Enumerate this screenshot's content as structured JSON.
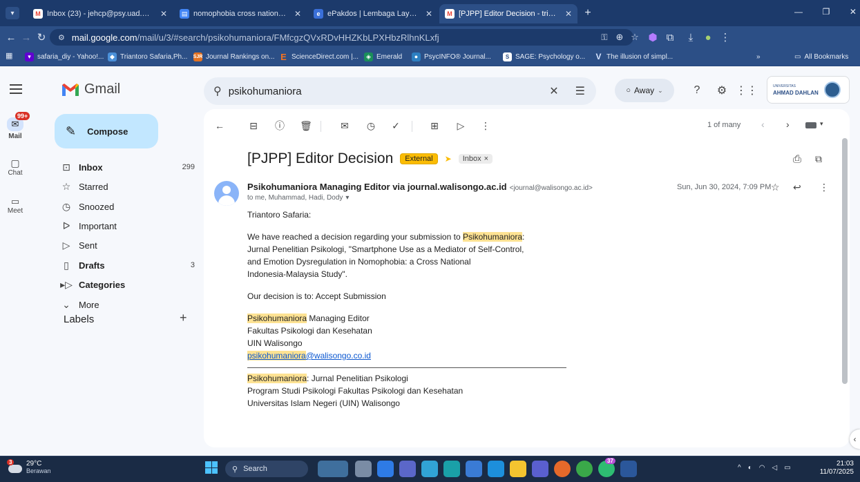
{
  "browser": {
    "tabs": [
      {
        "title": "Inbox (23) - jehcp@psy.uad.ac.i",
        "icon": "gmail-icon",
        "active": false
      },
      {
        "title": "nomophobia cross national stu",
        "icon": "docs-icon",
        "active": false
      },
      {
        "title": "ePakdos | Lembaga Layanan Pe",
        "icon": "epakdos-icon",
        "active": false
      },
      {
        "title": "[PJPP] Editor Decision - trianto",
        "icon": "gmail-icon",
        "active": true
      }
    ],
    "url_host": "mail.google.com",
    "url_path": "/mail/u/3/#search/psikohumaniora/FMfcgzQVxRDvHHZKbLPXHbzRlhnKLxfj",
    "bookmarks": [
      "safaria_diy - Yahoo!...",
      "Triantoro Safaria,Ph...",
      "Journal Rankings on...",
      "ScienceDirect.com |...",
      "Emerald",
      "PsycINFO® Journal...",
      "SAGE: Psychology o...",
      "The illusion of simpl..."
    ],
    "all_bookmarks": "All Bookmarks"
  },
  "gmail": {
    "logo_text": "Gmail",
    "rail": {
      "mail": "Mail",
      "mail_badge": "99+",
      "chat": "Chat",
      "meet": "Meet"
    },
    "compose": "Compose",
    "nav": [
      {
        "label": "Inbox",
        "count": "299",
        "bold": true
      },
      {
        "label": "Starred",
        "count": "",
        "bold": false
      },
      {
        "label": "Snoozed",
        "count": "",
        "bold": false
      },
      {
        "label": "Important",
        "count": "",
        "bold": false
      },
      {
        "label": "Sent",
        "count": "",
        "bold": false
      },
      {
        "label": "Drafts",
        "count": "3",
        "bold": true
      },
      {
        "label": "Categories",
        "count": "",
        "bold": true
      },
      {
        "label": "More",
        "count": "",
        "bold": false
      }
    ],
    "labels_title": "Labels",
    "search_value": "psikohumaniora",
    "status": "Away",
    "org_small": "UNIVERSITAS",
    "org_name": "AHMAD DAHLAN",
    "pagination": "1 of many"
  },
  "email": {
    "subject": "[PJPP] Editor Decision",
    "label_external": "External",
    "label_inbox": "Inbox",
    "sender": "Psikohumaniora Managing Editor via journal.walisongo.ac.id",
    "sender_email": "<journal@walisongo.ac.id>",
    "recipients": "to me, Muhammad, Hadi, Dody",
    "date": "Sun, Jun 30, 2024, 7:09 PM",
    "greeting": "Triantoro Safaria:",
    "p1_a": "We have reached a decision regarding your submission to ",
    "p1_hl": "Psikohumaniora",
    "p1_b": ":",
    "p1_l2": "Jurnal Penelitian Psikologi, \"Smartphone Use as a Mediator of Self-Control,",
    "p1_l3": "and Emotion Dysregulation in Nomophobia: a Cross National",
    "p1_l4": "Indonesia-Malaysia Study\".",
    "decision": "Our decision is to: Accept Submission",
    "sig_hl": "Psikohumaniora",
    "sig_rest": " Managing Editor",
    "sig_l2": "Fakultas Psikologi dan Kesehatan",
    "sig_l3": "UIN Walisongo",
    "sig_mail_hl": "psikohumaniora",
    "sig_mail_rest": "@walisongo.co.id",
    "foot_hl": "Psikohumaniora",
    "foot_rest": ": Jurnal Penelitian Psikologi",
    "foot_l2": "Program Studi Psikologi Fakultas Psikologi dan Kesehatan",
    "foot_l3": "Universitas Islam Negeri (UIN) Walisongo"
  },
  "taskbar": {
    "weather_badge": "3",
    "temp": "29°C",
    "condition": "Berawan",
    "search": "Search",
    "chrome_badge": "37",
    "time": "21:03",
    "date": "11/07/2025"
  },
  "colors": {
    "accent": "#0b57d0",
    "external_badge": "#fbbc04",
    "highlight": "#fde293",
    "gmail_red": "#ea4335"
  }
}
